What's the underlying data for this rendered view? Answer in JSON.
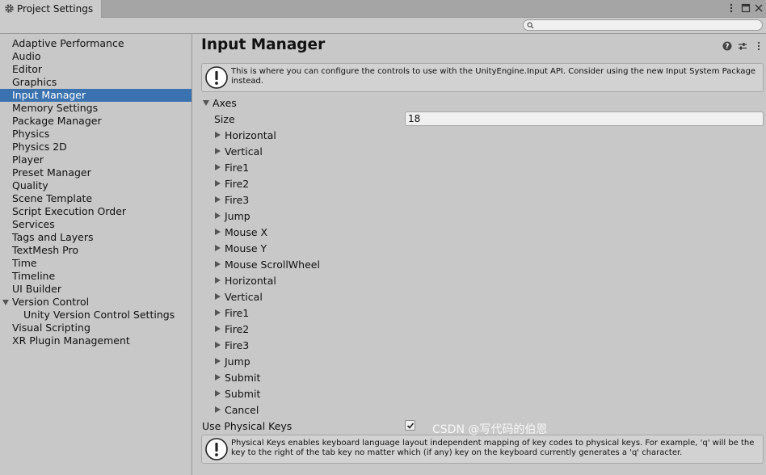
{
  "window": {
    "tab_title": "Project Settings",
    "tab_icon": "gear-icon"
  },
  "search": {
    "placeholder": "",
    "value": ""
  },
  "sidebar": {
    "items": [
      {
        "label": "Adaptive Performance"
      },
      {
        "label": "Audio"
      },
      {
        "label": "Editor"
      },
      {
        "label": "Graphics"
      },
      {
        "label": "Input Manager",
        "selected": true
      },
      {
        "label": "Memory Settings"
      },
      {
        "label": "Package Manager"
      },
      {
        "label": "Physics"
      },
      {
        "label": "Physics 2D"
      },
      {
        "label": "Player"
      },
      {
        "label": "Preset Manager"
      },
      {
        "label": "Quality"
      },
      {
        "label": "Scene Template"
      },
      {
        "label": "Script Execution Order"
      },
      {
        "label": "Services"
      },
      {
        "label": "Tags and Layers"
      },
      {
        "label": "TextMesh Pro"
      },
      {
        "label": "Time"
      },
      {
        "label": "Timeline"
      },
      {
        "label": "UI Builder"
      },
      {
        "label": "Version Control",
        "expanded": true
      },
      {
        "label": "Unity Version Control Settings",
        "child": true
      },
      {
        "label": "Visual Scripting"
      },
      {
        "label": "XR Plugin Management"
      }
    ],
    "selected_color": "#3a72b0"
  },
  "main": {
    "title": "Input Manager",
    "info_message": "This is where you can configure the controls to use with the UnityEngine.Input API. Consider using the new Input System Package instead.",
    "axes_label": "Axes",
    "size_label": "Size",
    "size_value": "18",
    "axes": [
      "Horizontal",
      "Vertical",
      "Fire1",
      "Fire2",
      "Fire3",
      "Jump",
      "Mouse X",
      "Mouse Y",
      "Mouse ScrollWheel",
      "Horizontal",
      "Vertical",
      "Fire1",
      "Fire2",
      "Fire3",
      "Jump",
      "Submit",
      "Submit",
      "Cancel"
    ],
    "physical_keys_label": "Use Physical Keys",
    "physical_keys_checked": true,
    "physical_keys_message": "Physical Keys enables keyboard language layout independent mapping of key codes to physical keys. For example, 'q' will be the key to the right of the tab key no matter which (if any) key on the keyboard currently generates a 'q' character."
  },
  "watermark": "CSDN @写代码的伯恩"
}
